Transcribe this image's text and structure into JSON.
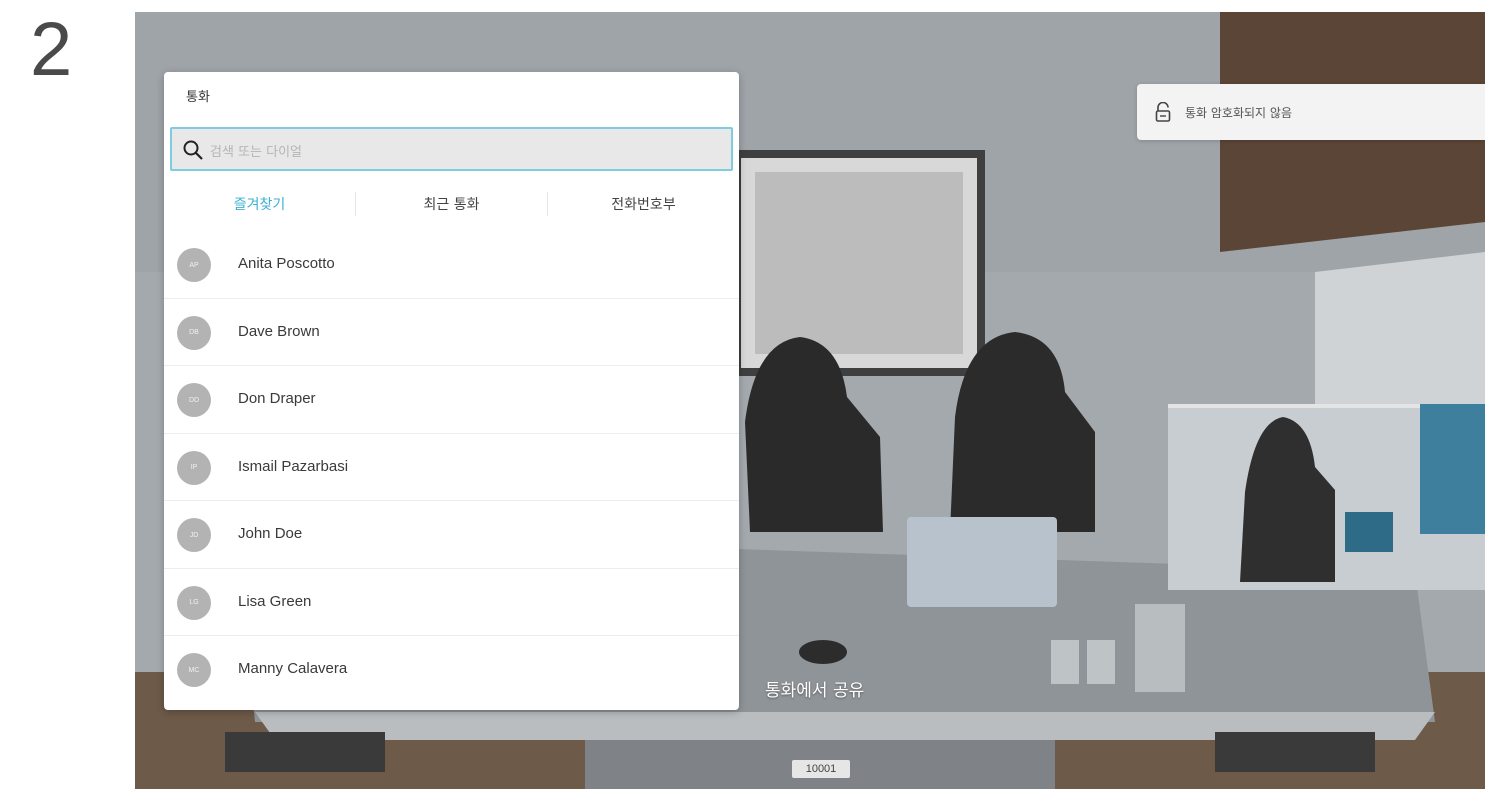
{
  "step": {
    "number": "2"
  },
  "panel": {
    "title": "통화",
    "search_placeholder": "검색 또는 다이얼",
    "tabs": [
      {
        "label": "즐겨찾기",
        "active": true
      },
      {
        "label": "최근 통화",
        "active": false
      },
      {
        "label": "전화번호부",
        "active": false
      }
    ],
    "contacts": [
      {
        "initials": "AP",
        "name": "Anita Poscotto"
      },
      {
        "initials": "DB",
        "name": "Dave Brown"
      },
      {
        "initials": "DD",
        "name": "Don Draper"
      },
      {
        "initials": "IP",
        "name": "Ismail Pazarbasi"
      },
      {
        "initials": "JD",
        "name": "John Doe"
      },
      {
        "initials": "LG",
        "name": "Lisa Green"
      },
      {
        "initials": "MC",
        "name": "Manny Calavera"
      }
    ]
  },
  "encryption": {
    "text": "통화 암호화되지 않음",
    "icon": "lock-open-icon"
  },
  "share": {
    "label": "통화에서 공유"
  },
  "extension": {
    "number": "10001"
  },
  "colors": {
    "accent": "#3ab1d3",
    "avatar": "#b3b3b3",
    "panel_bg": "#ffffff"
  }
}
